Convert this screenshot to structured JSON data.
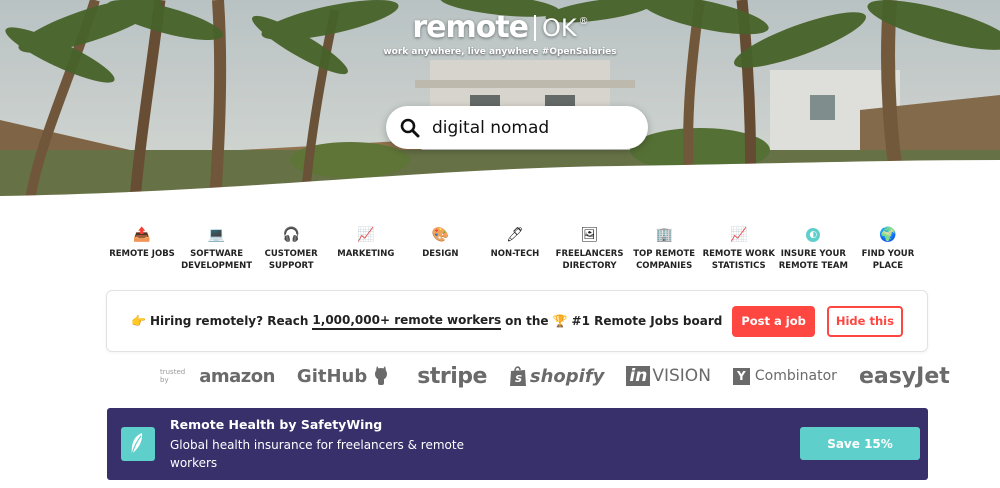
{
  "header": {
    "logo_main": "remote",
    "logo_suffix": "OK",
    "logo_mark": "®",
    "tagline": "work anywhere, live anywhere #OpenSalaries"
  },
  "search": {
    "value": "digital nomad",
    "icon": "search-icon"
  },
  "categories": [
    {
      "label": "REMOTE JOBS",
      "icon": "outbox-icon",
      "glyph": "📤"
    },
    {
      "label": "SOFTWARE\nDEVELOPMENT",
      "icon": "laptop-icon",
      "glyph": "💻"
    },
    {
      "label": "CUSTOMER\nSUPPORT",
      "icon": "headphones-icon",
      "glyph": "🎧"
    },
    {
      "label": "MARKETING",
      "icon": "chart-icon",
      "glyph": "📈"
    },
    {
      "label": "DESIGN",
      "icon": "palette-icon",
      "glyph": "🎨"
    },
    {
      "label": "NON-TECH",
      "icon": "pen-icon",
      "glyph": "🖊"
    },
    {
      "label": "FREELANCERS\nDIRECTORY",
      "icon": "picture-icon",
      "glyph": "🖼"
    },
    {
      "label": "TOP REMOTE\nCOMPANIES",
      "icon": "building-icon",
      "glyph": "🏢"
    },
    {
      "label": "REMOTE WORK\nSTATISTICS",
      "icon": "chart-icon",
      "glyph": "📈"
    },
    {
      "label": "INSURE YOUR\nREMOTE TEAM",
      "icon": "health-icon",
      "glyph": "◐"
    },
    {
      "label": "FIND YOUR\nPLACE",
      "icon": "globe-icon",
      "glyph": "🌍"
    }
  ],
  "hiring": {
    "emoji": "👉",
    "text_before": "Hiring remotely? Reach",
    "highlight": "1,000,000+ remote workers",
    "text_on": "on the",
    "trophy": "🏆",
    "text_after": "#1 Remote Jobs board",
    "post_label": "Post a job",
    "hide_label": "Hide this"
  },
  "trusted": {
    "label": "trusted by",
    "brands": {
      "amazon": "amazon",
      "github": "GitHub",
      "stripe": "stripe",
      "shopify": "shopify",
      "invision_box": "in",
      "invision_rest": "VISION",
      "yc_letter": "Y",
      "yc_rest": "Combinator",
      "easyjet": "easyJet"
    }
  },
  "ad": {
    "title": "Remote Health by SafetyWing",
    "description": "Global health insurance for freelancers & remote workers",
    "button_label": "Save 15%",
    "icon": "feather-icon",
    "background_color": "#37306b",
    "accent_color": "#5fcfcb"
  },
  "colors": {
    "accent_red": "#ff4742"
  }
}
